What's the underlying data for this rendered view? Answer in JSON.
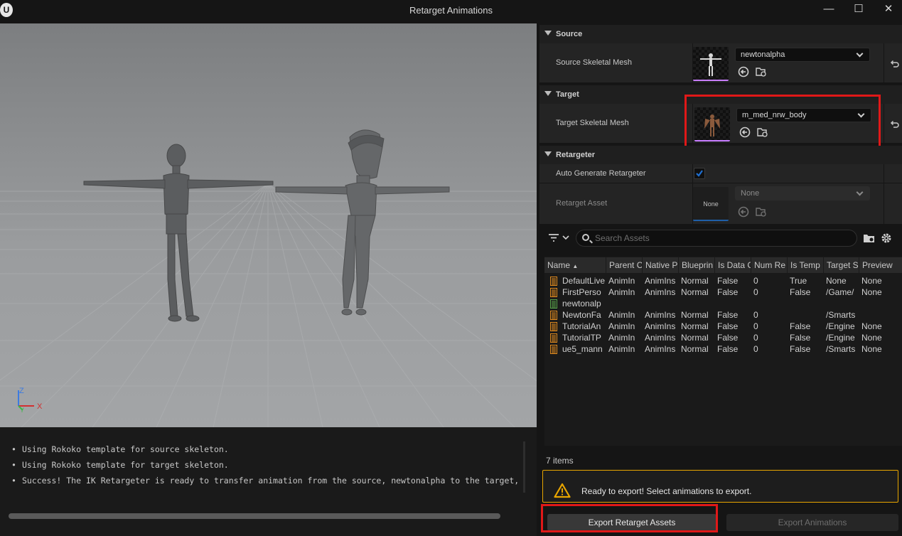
{
  "window": {
    "title": "Retarget Animations",
    "logo_label": "U",
    "minimize_glyph": "—",
    "maximize_glyph": "☐",
    "close_glyph": "✕"
  },
  "viewport": {
    "axis": {
      "z": "Z",
      "y": "Y",
      "x": "X"
    }
  },
  "log": {
    "bullet": "•",
    "lines": [
      "Using Rokoko template for source skeleton.",
      "Using Rokoko template for target skeleton.",
      "Success! The IK Retargeter is ready to transfer animation from the source, newtonalpha to the target,"
    ]
  },
  "details": {
    "source": {
      "header": "Source",
      "label": "Source Skeletal Mesh",
      "value": "newtonalpha"
    },
    "target": {
      "header": "Target",
      "label": "Target Skeletal Mesh",
      "value": "m_med_nrw_body"
    },
    "retargeter": {
      "header": "Retargeter",
      "auto_label": "Auto Generate Retargeter",
      "auto_checked": true,
      "asset_label": "Retarget Asset",
      "asset_value": "None",
      "asset_thumb_text": "None"
    }
  },
  "assets": {
    "search_placeholder": "Search Assets",
    "columns": [
      "Name",
      "Parent C",
      "Native P",
      "Blueprin",
      "Is Data C",
      "Num Re",
      "Is Temp",
      "Target S",
      "Preview"
    ],
    "sort_glyph": "▲",
    "rows": [
      {
        "kind": "anim",
        "cells": [
          "DefaultLive",
          "AnimIn",
          "AnimIns",
          "Normal",
          "False",
          "0",
          "True",
          "None",
          "None"
        ]
      },
      {
        "kind": "anim",
        "cells": [
          "FirstPerso",
          "AnimIn",
          "AnimIns",
          "Normal",
          "False",
          "0",
          "False",
          "/Game/",
          "None"
        ]
      },
      {
        "kind": "mesh",
        "cells": [
          "newtonalp",
          "",
          "",
          "",
          "",
          "",
          "",
          "",
          ""
        ]
      },
      {
        "kind": "anim",
        "cells": [
          "NewtonFa",
          "AnimIn",
          "AnimIns",
          "Normal",
          "False",
          "0",
          "",
          "/Smarts",
          ""
        ]
      },
      {
        "kind": "anim",
        "cells": [
          "TutorialAn",
          "AnimIn",
          "AnimIns",
          "Normal",
          "False",
          "0",
          "False",
          "/Engine",
          "None"
        ]
      },
      {
        "kind": "anim",
        "cells": [
          "TutorialTP",
          "AnimIn",
          "AnimIns",
          "Normal",
          "False",
          "0",
          "False",
          "/Engine",
          "None"
        ]
      },
      {
        "kind": "anim",
        "cells": [
          "ue5_mann",
          "AnimIn",
          "AnimIns",
          "Normal",
          "False",
          "0",
          "False",
          "/Smarts",
          "None"
        ]
      }
    ],
    "count_text": "7 items"
  },
  "footer": {
    "warning_text": "Ready to export! Select animations to export.",
    "export_retarget_label": "Export Retarget Assets",
    "export_animations_label": "Export Animations"
  },
  "colors": {
    "accent_pink": "#c77dff",
    "highlight_red": "#e01818",
    "warning_amber": "#e8a500",
    "anim_icon": "#e08a1e",
    "mesh_icon": "#58a34a",
    "checkbox_blue": "#1f6fd1"
  }
}
